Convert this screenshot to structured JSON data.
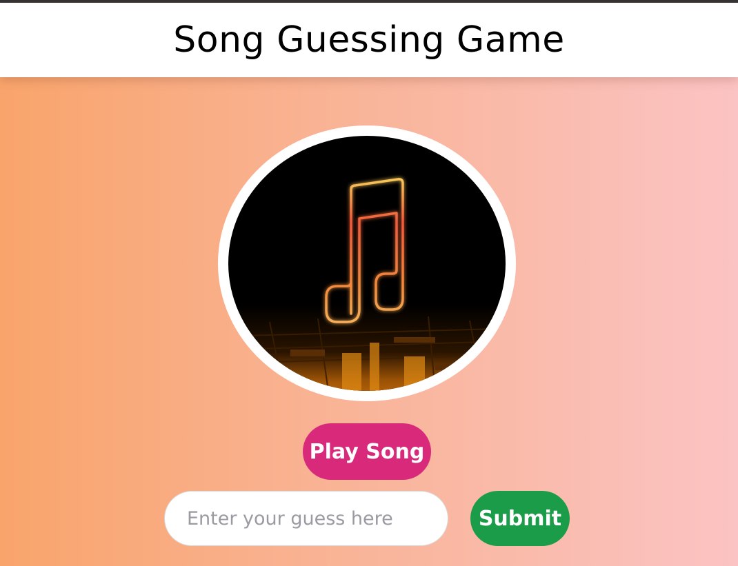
{
  "header": {
    "title": "Song Guessing Game"
  },
  "artwork": {
    "icon": "music-note-icon",
    "accent_colors": [
      "#f6c65a",
      "#e8463a",
      "#f39a2c"
    ]
  },
  "controls": {
    "play_label": "Play Song",
    "guess_placeholder": "Enter your guess here",
    "guess_value": "",
    "submit_label": "Submit"
  },
  "colors": {
    "gradient_start": "#f9a46b",
    "gradient_end": "#fbc3c3",
    "play_button": "#d8297b",
    "submit_button": "#1a9c48"
  }
}
